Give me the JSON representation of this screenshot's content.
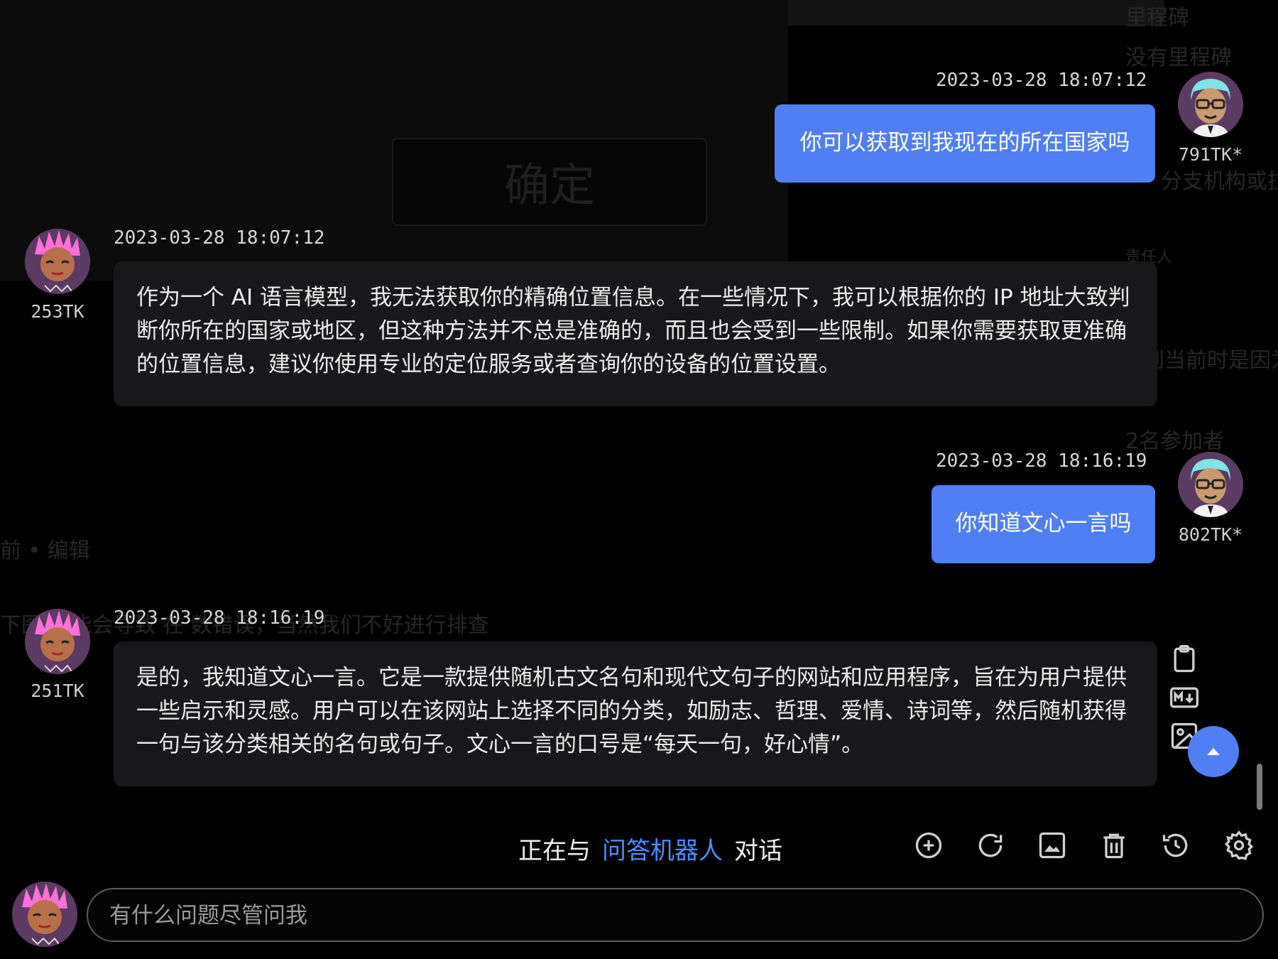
{
  "ghost": {
    "milestone_title": "里程碑",
    "no_milestone": "没有里程碑",
    "confirm": "确定",
    "branch_hint": "分支机构或拉",
    "owner_hint": "责任人",
    "reason_hint": "到当前时是因为",
    "participants": "2名参加者",
    "edit_hint": "前 • 编辑",
    "error_hint": "下图 可能会导致 在 数错误，当然我们不好进行排查"
  },
  "conversation": [
    {
      "role": "user",
      "time": "2023-03-28 18:07:12",
      "text": "你可以获取到我现在的所在国家吗",
      "tokens": "791TK*"
    },
    {
      "role": "bot",
      "time": "2023-03-28 18:07:12",
      "text": "作为一个 AI 语言模型，我无法获取你的精确位置信息。在一些情况下，我可以根据你的 IP 地址大致判断你所在的国家或地区，但这种方法并不总是准确的，而且也会受到一些限制。如果你需要获取更准确的位置信息，建议你使用专业的定位服务或者查询你的设备的位置设置。",
      "tokens": "253TK"
    },
    {
      "role": "user",
      "time": "2023-03-28 18:16:19",
      "text": "你知道文心一言吗",
      "tokens": "802TK*"
    },
    {
      "role": "bot",
      "time": "2023-03-28 18:16:19",
      "text": "是的，我知道文心一言。它是一款提供随机古文名句和现代文句子的网站和应用程序，旨在为用户提供一些启示和灵感。用户可以在该网站上选择不同的分类，如励志、哲理、爱情、诗词等，然后随机获得一句与该分类相关的名句或句子。文心一言的口号是“每天一句，好心情”。",
      "tokens": "251TK"
    }
  ],
  "status": {
    "prefix": "正在与",
    "bot_name": "问答机器人",
    "suffix": "对话"
  },
  "input": {
    "placeholder": "有什么问题尽管问我"
  },
  "icons": {
    "side_tools": [
      "clipboard-icon",
      "markdown-icon",
      "image-icon"
    ],
    "toolbar": [
      "new-chat-icon",
      "refresh-icon",
      "image-icon",
      "trash-icon",
      "history-icon",
      "settings-icon"
    ],
    "scroll_top": "arrow-up-icon"
  },
  "colors": {
    "accent": "#4f7ff3",
    "bot_name": "#4f8cff",
    "bot_bubble": "#18181a",
    "background": "#000000"
  }
}
